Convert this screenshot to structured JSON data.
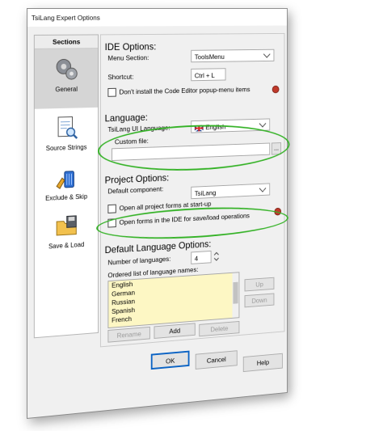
{
  "window": {
    "title": "TsiLang Expert Options"
  },
  "sidebar": {
    "header": "Sections",
    "items": [
      {
        "label": "General"
      },
      {
        "label": "Source Strings"
      },
      {
        "label": "Exclude & Skip"
      },
      {
        "label": "Save & Load"
      }
    ]
  },
  "ide": {
    "title": "IDE Options:",
    "menu_section_label": "Menu Section:",
    "menu_section_value": "ToolsMenu",
    "shortcut_label": "Shortcut:",
    "shortcut_value": "Ctrl + L",
    "dont_install_label": "Don't install the Code Editor popup-menu items"
  },
  "language": {
    "title": "Language:",
    "ui_language_label": "TsiLang UI Language:",
    "ui_language_value": "English",
    "custom_file_label": "Custom file:",
    "custom_file_value": "",
    "browse_label": "..."
  },
  "project": {
    "title": "Project Options:",
    "default_component_label": "Default component:",
    "default_component_value": "TsiLang",
    "open_all_label": "Open all project forms at start-up",
    "open_forms_label": "Open forms in the IDE for save/load operations"
  },
  "default_lang": {
    "title": "Default Language Options:",
    "num_label": "Number of languages:",
    "num_value": "4",
    "list_label": "Ordered list of language names:",
    "languages": [
      "English",
      "German",
      "Russian",
      "Spanish",
      "French"
    ],
    "up_label": "Up",
    "down_label": "Down",
    "rename_label": "Rename",
    "add_label": "Add",
    "delete_label": "Delete"
  },
  "footer": {
    "ok_label": "OK",
    "cancel_label": "Cancel",
    "help_label": "Help"
  },
  "colors": {
    "highlight": "#34b226",
    "list_bg": "#fdf7c4"
  }
}
